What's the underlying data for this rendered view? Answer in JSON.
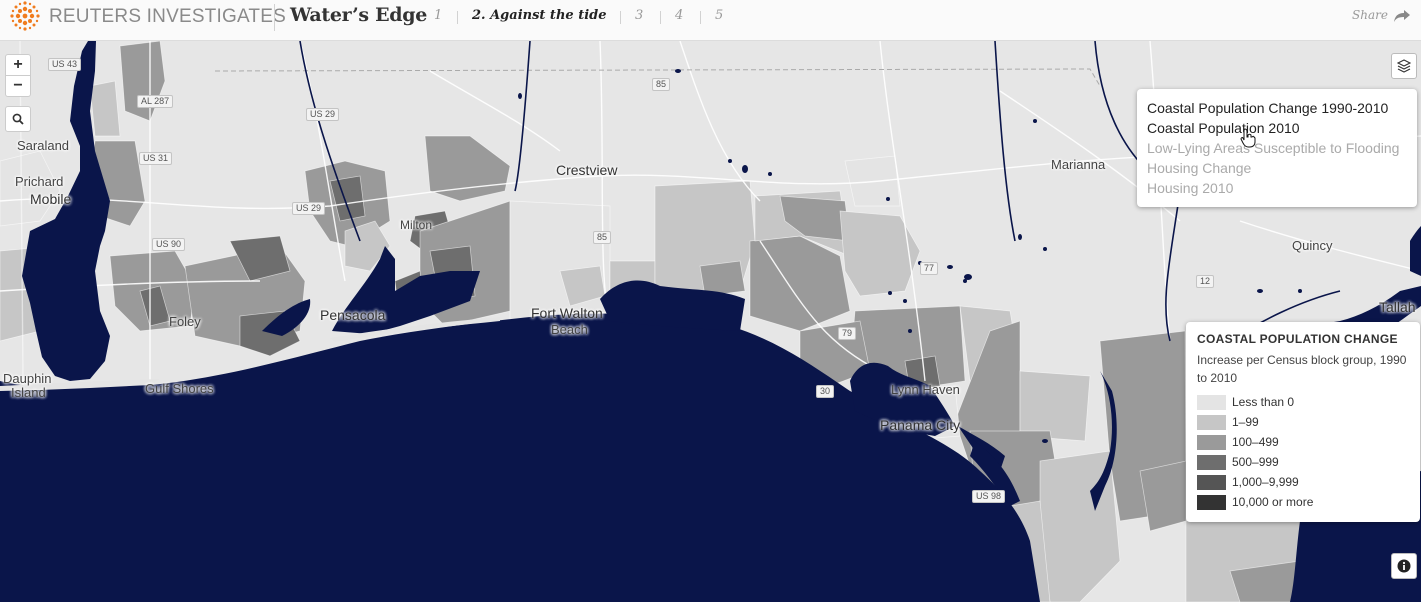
{
  "header": {
    "brand": "REUTERS INVESTIGATES",
    "story_title": "Water’s Edge",
    "chapters": [
      {
        "label": "1",
        "active": false
      },
      {
        "label": "2. Against the tide",
        "active": true
      },
      {
        "label": "3",
        "active": false
      },
      {
        "label": "4",
        "active": false
      },
      {
        "label": "5",
        "active": false
      }
    ],
    "share_label": "Share"
  },
  "map": {
    "zoom_in": "+",
    "zoom_out": "−",
    "places": {
      "saraland": "Saraland",
      "prichard": "Prichard",
      "mobile": "Mobile",
      "crestview": "Crestview",
      "milton": "Milton",
      "marianna": "Marianna",
      "quincy": "Quincy",
      "tallahassee": "Tallah",
      "foley": "Foley",
      "pensacola": "Pensacola",
      "fort_walton_1": "Fort Walton",
      "fort_walton_2": "Beach",
      "dauphin_1": "Dauphin",
      "dauphin_2": "Island",
      "gulf_shores": "Gulf Shores",
      "lynn_haven": "Lynn Haven",
      "panama_city": "Panama City"
    },
    "shields": {
      "us43": "US 43",
      "al287": "AL 287",
      "us29a": "US 29",
      "us31": "US 31",
      "us29b": "US 29",
      "us90": "US 90",
      "r85a": "85",
      "r85b": "85",
      "r77": "77",
      "r79": "79",
      "r12": "12",
      "r30": "30",
      "us98": "US 98"
    }
  },
  "layers_menu": {
    "items": [
      {
        "label": "Coastal Population Change 1990-2010",
        "active": true
      },
      {
        "label": "Coastal Population 2010",
        "active": true
      },
      {
        "label": "Low-Lying Areas Susceptible to Flooding",
        "active": false
      },
      {
        "label": "Housing Change",
        "active": false
      },
      {
        "label": "Housing 2010",
        "active": false
      }
    ]
  },
  "legend": {
    "title": "COASTAL POPULATION CHANGE",
    "subtitle": "Increase per Census block group, 1990 to 2010",
    "entries": [
      {
        "label": "Less than 0",
        "color": "#e4e4e4"
      },
      {
        "label": "1–99",
        "color": "#c6c6c6"
      },
      {
        "label": "100–499",
        "color": "#9a9a9a"
      },
      {
        "label": "500–999",
        "color": "#6e6e6e"
      },
      {
        "label": "1,000–9,999",
        "color": "#555555"
      },
      {
        "label": "10,000 or more",
        "color": "#333333"
      }
    ]
  },
  "colors": {
    "water": "#0a154a",
    "land": "#e6e6e6"
  }
}
